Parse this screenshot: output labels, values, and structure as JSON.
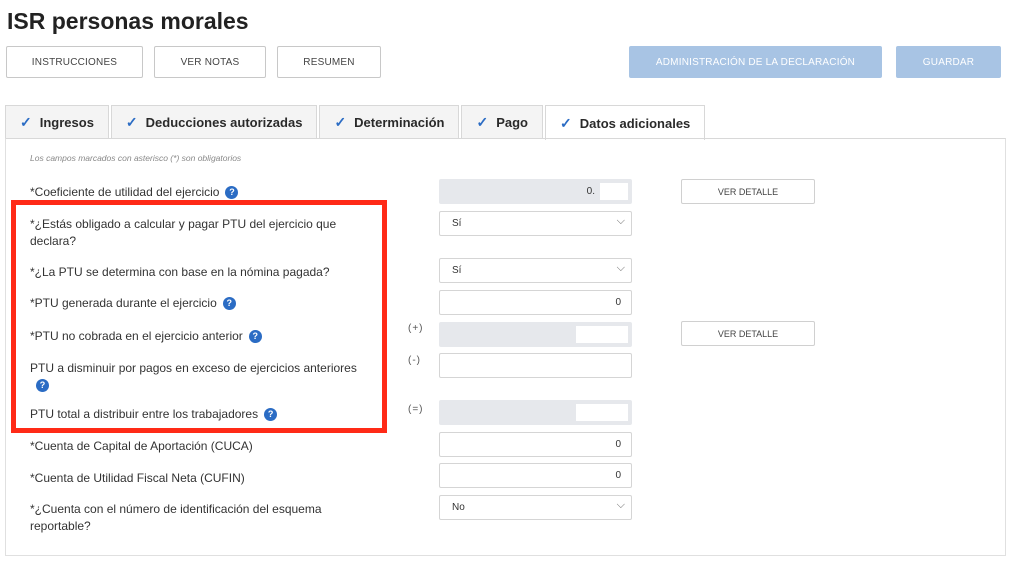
{
  "title": "ISR personas morales",
  "toolbar": {
    "instrucciones": "INSTRUCCIONES",
    "ver_notas": "VER NOTAS",
    "resumen": "RESUMEN",
    "administracion": "ADMINISTRACIÓN DE LA DECLARACIÓN",
    "guardar": "GUARDAR"
  },
  "tabs": [
    {
      "label": "Ingresos"
    },
    {
      "label": "Deducciones autorizadas"
    },
    {
      "label": "Determinación"
    },
    {
      "label": "Pago"
    },
    {
      "label": "Datos adicionales"
    }
  ],
  "form": {
    "hint": "Los campos marcados con asterisco (*) son obligatorios",
    "coeficiente": {
      "label": "*Coeficiente de utilidad del ejercicio",
      "value": "0."
    },
    "obligado_ptu": {
      "label": "*¿Estás obligado a calcular y pagar PTU del ejercicio que declara?",
      "value": "Sí"
    },
    "ptu_nomina": {
      "label": "*¿La PTU se determina con base en la nómina pagada?",
      "value": "Sí"
    },
    "ptu_generada": {
      "label": "*PTU generada durante el ejercicio",
      "value": "0"
    },
    "ptu_no_cobrada": {
      "label": "*PTU no cobrada en el ejercicio anterior",
      "operator": "(+)"
    },
    "ptu_disminuir": {
      "label": "PTU a disminuir por pagos en exceso de ejercicios anteriores",
      "operator": "(-)"
    },
    "ptu_total": {
      "label": "PTU total a distribuir entre los trabajadores",
      "operator": "(=)"
    },
    "cuca": {
      "label": "*Cuenta de Capital de Aportación (CUCA)",
      "value": "0"
    },
    "cufin": {
      "label": "*Cuenta de Utilidad Fiscal Neta (CUFIN)",
      "value": "0"
    },
    "esquema": {
      "label": "*¿Cuenta con el número de identificación del esquema reportable?",
      "value": "No"
    },
    "ver_detalle": "VER DETALLE"
  },
  "colors": {
    "accent": "#2b6cc4",
    "primary_button": "#a8c4e4",
    "highlight": "#ff2a17",
    "readonly_field": "#e6e8ec"
  }
}
